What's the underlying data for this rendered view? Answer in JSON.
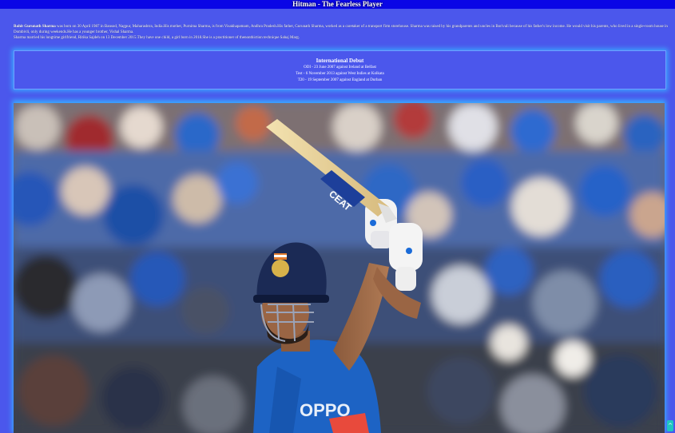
{
  "page": {
    "title": "Hitman - The Fearless Player"
  },
  "bio": {
    "name": "Rohit Gurunath Sharma",
    "paragraph1": " was born on 30 April 1987 in Bansod, Nagpur, Maharashtra, India.His mother, Purnima Sharma, is from Visakhapatnam, Andhra Pradesh.His father, Gurunath Sharma, worked as a caretaker of a transport firm storehouse. Sharma was raised by his grandparents and uncles in Borivali because of his father's low income. He would visit his parents, who lived in a single-room house in Dombivli, only during weekends.He has a younger brother, Vishal Sharma.",
    "paragraph2": "Sharma married his longtime girlfriend, Ritika Sajdeh on 13 December 2015.They have one child, a girl born in 2018.She is a practitioner of thenonthiction technique Sahaj Marg."
  },
  "debut": {
    "heading": "International Debut",
    "odi": "ODI - 23 June 2007 against Ireland at Belfast",
    "test": "Test - 6 November 2013 against West Indies at Kolkata",
    "t20": "T20 - 19 September 2007 against England at Durban"
  },
  "photo": {
    "jersey_text": "OPPO",
    "bat_text": "CEAT"
  },
  "scroll_button": {
    "icon": "arrow-up-icon",
    "glyph": "^"
  },
  "colors": {
    "background": "#4b57ec",
    "topbar": "#0a06e6",
    "glow": "#3aa9ff",
    "jersey": "#1d63c4",
    "scroll_button": "#1fc7c0"
  }
}
